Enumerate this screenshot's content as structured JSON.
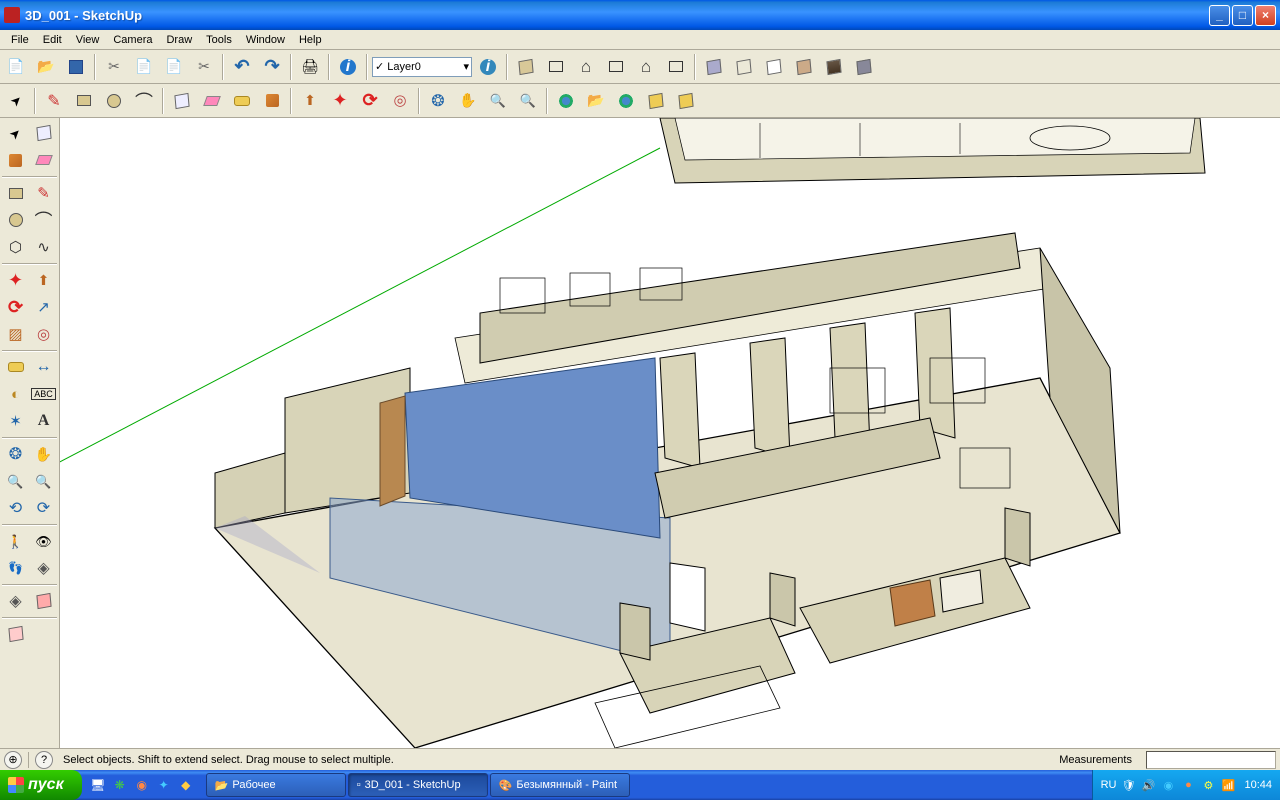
{
  "window": {
    "title": "3D_001 - SketchUp"
  },
  "menu": {
    "file": "File",
    "edit": "Edit",
    "view": "View",
    "camera": "Camera",
    "draw": "Draw",
    "tools": "Tools",
    "window": "Window",
    "help": "Help"
  },
  "toolbar": {
    "layer_label": "Layer0",
    "info_letter": "i"
  },
  "status": {
    "hint": "Select objects. Shift to extend select. Drag mouse to select multiple.",
    "measurements_label": "Measurements",
    "help_icon": "?",
    "geo_icon": "⊕"
  },
  "taskbar": {
    "start": "пуск",
    "items": [
      {
        "label": "Рабочее",
        "icon": "📂"
      },
      {
        "label": "3D_001 - SketchUp",
        "icon": "▫"
      },
      {
        "label": "Безымянный - Paint",
        "icon": "🎨"
      }
    ],
    "lang": "RU",
    "time": "10:44"
  }
}
